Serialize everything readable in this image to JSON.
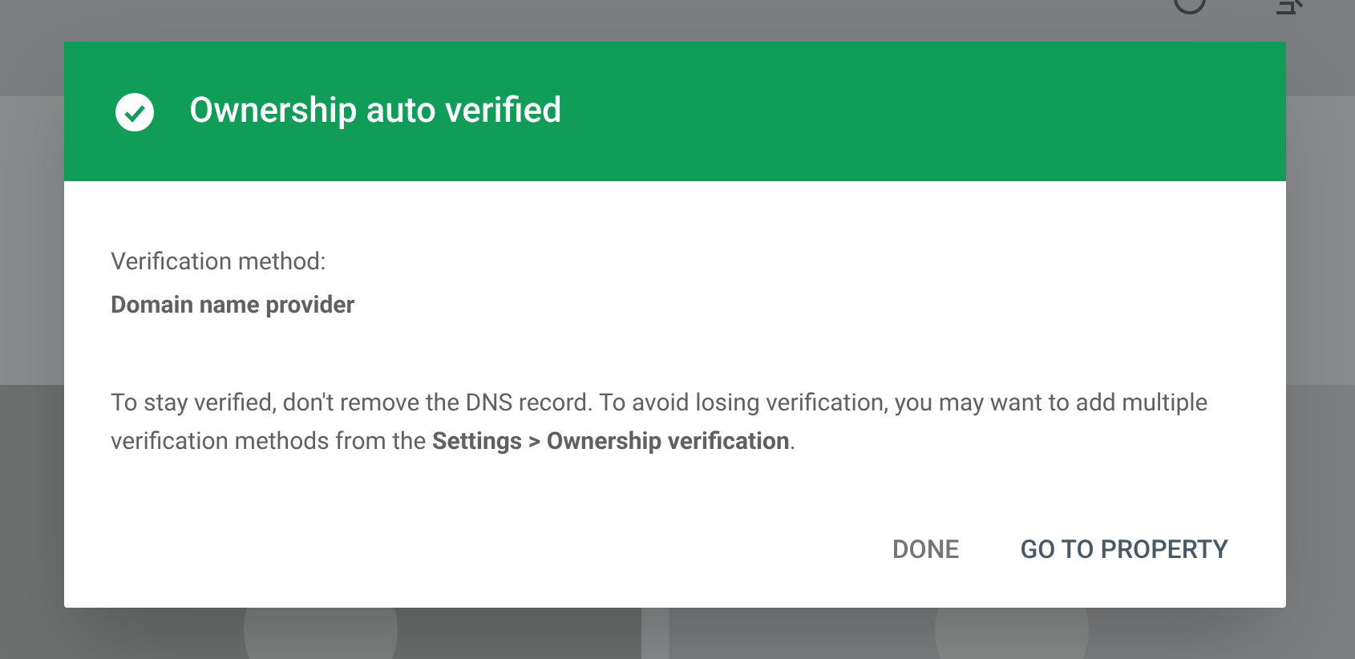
{
  "dialog": {
    "title": "Ownership auto verified",
    "method_label": "Verification method:",
    "method_value": "Domain name provider",
    "note": "To stay verified, don't remove the DNS record. To avoid losing verification, you may want to add multiple verification methods from the **Settings > Ownership verification**.",
    "buttons": [
      {
        "label": "DONE",
        "kind": "secondary"
      },
      {
        "label": "GO TO PROPERTY",
        "kind": "primary"
      }
    ]
  }
}
